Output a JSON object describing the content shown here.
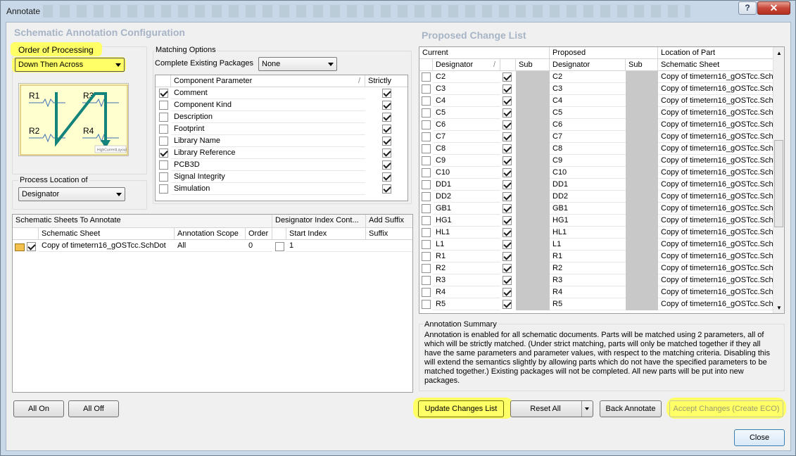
{
  "window": {
    "title": "Annotate",
    "help": "?",
    "close": "✕"
  },
  "config": {
    "title": "Schematic Annotation Configuration",
    "order_label": "Order of Processing",
    "order_value": "Down Then Across",
    "location_label": "Process Location of",
    "location_value": "Designator",
    "diagram_labels": [
      "R1",
      "R3",
      "R2",
      "R4"
    ],
    "diagram_caption": "HighCurrentLayout"
  },
  "matching": {
    "title": "Matching Options",
    "complete_label": "Complete Existing Packages",
    "complete_value": "None",
    "col_param": "Component Parameter",
    "col_strict": "Strictly",
    "params": [
      {
        "name": "Comment",
        "checked": true,
        "strict": true
      },
      {
        "name": "Component Kind",
        "checked": false,
        "strict": true
      },
      {
        "name": "Description",
        "checked": false,
        "strict": true
      },
      {
        "name": "Footprint",
        "checked": false,
        "strict": true
      },
      {
        "name": "Library Name",
        "checked": false,
        "strict": true
      },
      {
        "name": "Library Reference",
        "checked": true,
        "strict": true
      },
      {
        "name": "PCB3D",
        "checked": false,
        "strict": true
      },
      {
        "name": "Signal Integrity",
        "checked": false,
        "strict": true
      },
      {
        "name": "Simulation",
        "checked": false,
        "strict": true
      }
    ]
  },
  "sheets": {
    "group1": "Schematic Sheets To Annotate",
    "group2": "Designator Index Cont...",
    "group3": "Add Suffix",
    "cols": [
      "Schematic Sheet",
      "Annotation Scope",
      "Order",
      "Start Index",
      "Suffix"
    ],
    "rows": [
      {
        "sheet": "Copy of timetern16_gOSTcc.SchDot",
        "scope": "All",
        "order": "0",
        "start": "1",
        "suffix": ""
      }
    ]
  },
  "changes": {
    "title": "Proposed Change List",
    "hdr_current": "Current",
    "hdr_proposed": "Proposed",
    "hdr_location": "Location of Part",
    "col_designator": "Designator",
    "col_sub": "Sub",
    "col_sheet": "Schematic Sheet",
    "rows": [
      {
        "cur": "C2",
        "prop": "C2",
        "sheet": "Copy of timetern16_gOSTcc.Sch"
      },
      {
        "cur": "C3",
        "prop": "C3",
        "sheet": "Copy of timetern16_gOSTcc.Sch"
      },
      {
        "cur": "C4",
        "prop": "C4",
        "sheet": "Copy of timetern16_gOSTcc.Sch"
      },
      {
        "cur": "C5",
        "prop": "C5",
        "sheet": "Copy of timetern16_gOSTcc.Sch"
      },
      {
        "cur": "C6",
        "prop": "C6",
        "sheet": "Copy of timetern16_gOSTcc.Sch"
      },
      {
        "cur": "C7",
        "prop": "C7",
        "sheet": "Copy of timetern16_gOSTcc.Sch"
      },
      {
        "cur": "C8",
        "prop": "C8",
        "sheet": "Copy of timetern16_gOSTcc.Sch"
      },
      {
        "cur": "C9",
        "prop": "C9",
        "sheet": "Copy of timetern16_gOSTcc.Sch"
      },
      {
        "cur": "C10",
        "prop": "C10",
        "sheet": "Copy of timetern16_gOSTcc.Sch"
      },
      {
        "cur": "DD1",
        "prop": "DD1",
        "sheet": "Copy of timetern16_gOSTcc.Sch"
      },
      {
        "cur": "DD2",
        "prop": "DD2",
        "sheet": "Copy of timetern16_gOSTcc.Sch"
      },
      {
        "cur": "GB1",
        "prop": "GB1",
        "sheet": "Copy of timetern16_gOSTcc.Sch"
      },
      {
        "cur": "HG1",
        "prop": "HG1",
        "sheet": "Copy of timetern16_gOSTcc.Sch"
      },
      {
        "cur": "HL1",
        "prop": "HL1",
        "sheet": "Copy of timetern16_gOSTcc.Sch"
      },
      {
        "cur": "L1",
        "prop": "L1",
        "sheet": "Copy of timetern16_gOSTcc.Sch"
      },
      {
        "cur": "R1",
        "prop": "R1",
        "sheet": "Copy of timetern16_gOSTcc.Sch"
      },
      {
        "cur": "R2",
        "prop": "R2",
        "sheet": "Copy of timetern16_gOSTcc.Sch"
      },
      {
        "cur": "R3",
        "prop": "R3",
        "sheet": "Copy of timetern16_gOSTcc.Sch"
      },
      {
        "cur": "R4",
        "prop": "R4",
        "sheet": "Copy of timetern16_gOSTcc.Sch"
      },
      {
        "cur": "R5",
        "prop": "R5",
        "sheet": "Copy of timetern16_gOSTcc.Sch"
      }
    ]
  },
  "summary": {
    "title": "Annotation Summary",
    "text": "Annotation is enabled for all schematic documents. Parts will be matched using 2 parameters, all of which will be strictly matched. (Under strict matching, parts will only be matched together if they all have the same parameters and parameter values, with respect to the matching criteria. Disabling this will extend the semantics slightly by allowing parts which do not have the specified parameters to be matched together.) Existing packages will not be completed. All new parts will be put into new packages."
  },
  "buttons": {
    "all_on": "All On",
    "all_off": "All Off",
    "update": "Update Changes List",
    "reset": "Reset All",
    "back": "Back Annotate",
    "accept": "Accept Changes (Create ECO)",
    "close": "Close"
  }
}
